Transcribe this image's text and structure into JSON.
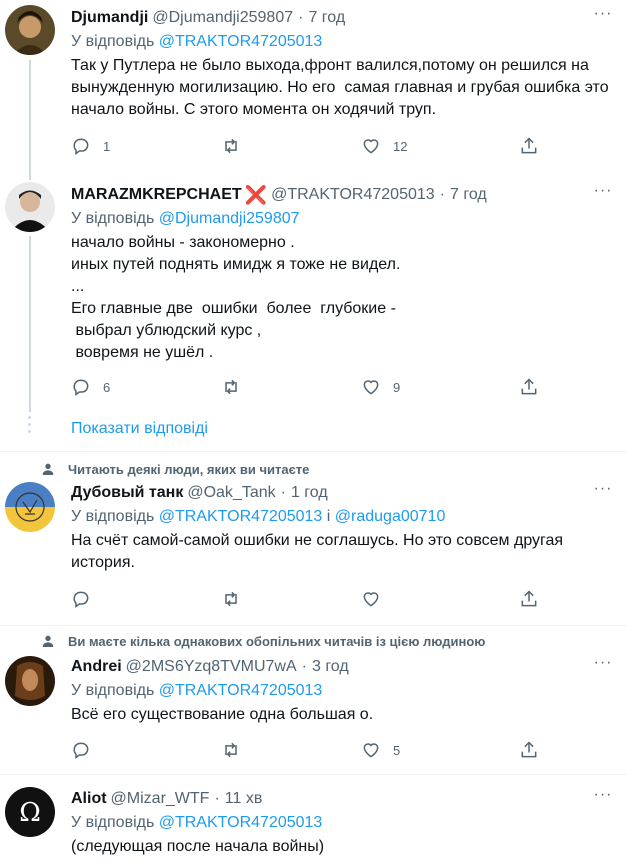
{
  "tweets": [
    {
      "name": "Djumandji",
      "handle": "@Djumandji259807",
      "time": "7 год",
      "reply_prefix": "У відповідь ",
      "reply_to": "@TRAKTOR47205013",
      "text": "Так у Путлера не было выхода,фронт валился,потому он решился на вынужденную могилизацию. Но его  самая главная и грубая ошибка это начало войны. С этого момента он ходячий труп.",
      "replies": "1",
      "retweets": "",
      "likes": "12"
    },
    {
      "name": "MARAZMKREPCHAET",
      "name_badge": "❌",
      "handle": "@TRAKTOR47205013",
      "time": "7 год",
      "reply_prefix": "У відповідь ",
      "reply_to": "@Djumandji259807",
      "text": "начало войны - закономерно .\nиных путей поднять имидж я тоже не видел.\n...\nЕго главные две  ошибки  более  глубокие -\n выбрал ублюдский курс ,\n вовремя не ушёл .",
      "replies": "6",
      "retweets": "",
      "likes": "9"
    },
    {
      "context": "Читають деякі люди, яких ви читаєте",
      "name": "Дубовый танк",
      "handle": "@Oak_Tank",
      "time": "1 год",
      "reply_prefix": "У відповідь ",
      "reply_to": "@TRAKTOR47205013",
      "reply_and": " і ",
      "reply_to_2": "@raduga00710",
      "text": "На счёт самой-самой ошибки не соглашусь. Но это совсем другая история.",
      "replies": "",
      "retweets": "",
      "likes": ""
    },
    {
      "context": "Ви маєте кілька однакових обопільних читачів із цією людиною",
      "name": "Andrei",
      "handle": "@2MS6Yzq8TVMU7wA",
      "time": "3 год",
      "reply_prefix": "У відповідь ",
      "reply_to": "@TRAKTOR47205013",
      "text": "Всё его существование одна большая о.",
      "replies": "",
      "retweets": "",
      "likes": "5"
    },
    {
      "name": "Aliot",
      "handle": "@Mizar_WTF",
      "time": "11 хв",
      "reply_prefix": "У відповідь ",
      "reply_to": "@TRAKTOR47205013",
      "text": "(следующая после начала войны)"
    }
  ],
  "show_replies": "Показати відповіді",
  "more_glyph": "···",
  "dot": "·",
  "colors": {
    "accent": "#1d9bf0",
    "muted": "#536471",
    "divider": "#eff3f4",
    "red_x": "#e0245e"
  },
  "icons": [
    "reply-icon",
    "retweet-icon",
    "like-icon",
    "share-icon",
    "person-icon",
    "more-icon"
  ]
}
